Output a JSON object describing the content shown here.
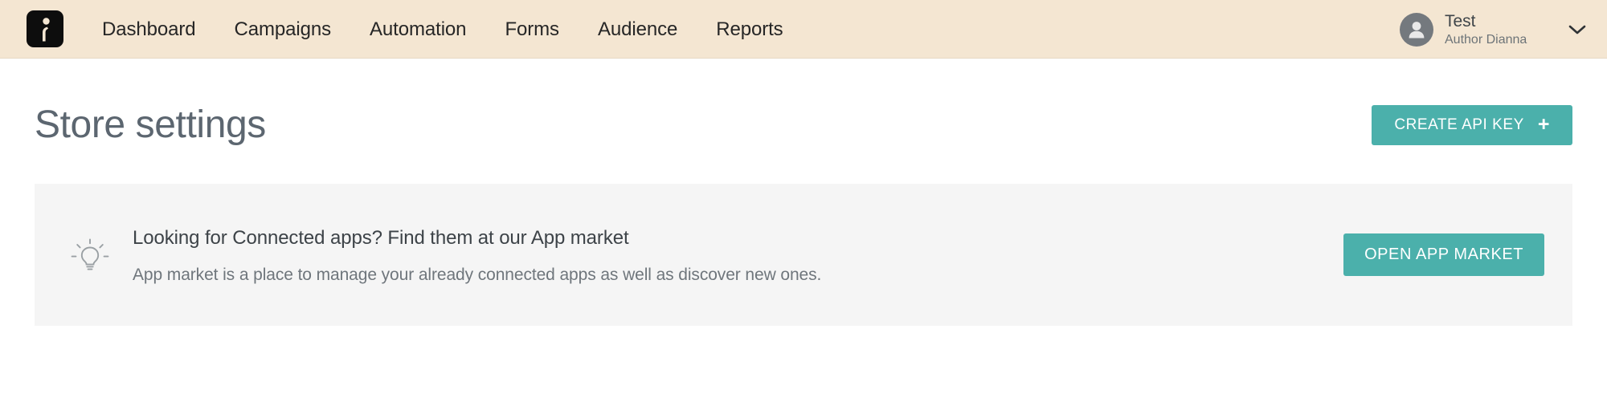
{
  "header": {
    "logo": {
      "icon": "brand-logo-icon",
      "alt": "Brand logo"
    },
    "nav": [
      {
        "label": "Dashboard",
        "name": "nav-dashboard"
      },
      {
        "label": "Campaigns",
        "name": "nav-campaigns"
      },
      {
        "label": "Automation",
        "name": "nav-automation"
      },
      {
        "label": "Forms",
        "name": "nav-forms"
      },
      {
        "label": "Audience",
        "name": "nav-audience"
      },
      {
        "label": "Reports",
        "name": "nav-reports"
      }
    ],
    "user": {
      "name": "Test",
      "role": "Author Dianna",
      "avatar_icon": "person-icon",
      "chevron_icon": "chevron-down-icon"
    },
    "background_color": "#f4e6d2"
  },
  "main": {
    "page_title": "Store settings",
    "create_api_key": {
      "label": "CREATE API KEY",
      "plus_glyph": "+",
      "color": "#4bb0ab"
    },
    "info_panel": {
      "icon": "lightbulb-icon",
      "heading": "Looking for Connected apps? Find them at our App market",
      "description": "App market is a place to manage your already connected apps as well as discover new ones.",
      "action_label": "OPEN APP MARKET",
      "background_color": "#f5f5f5"
    }
  }
}
